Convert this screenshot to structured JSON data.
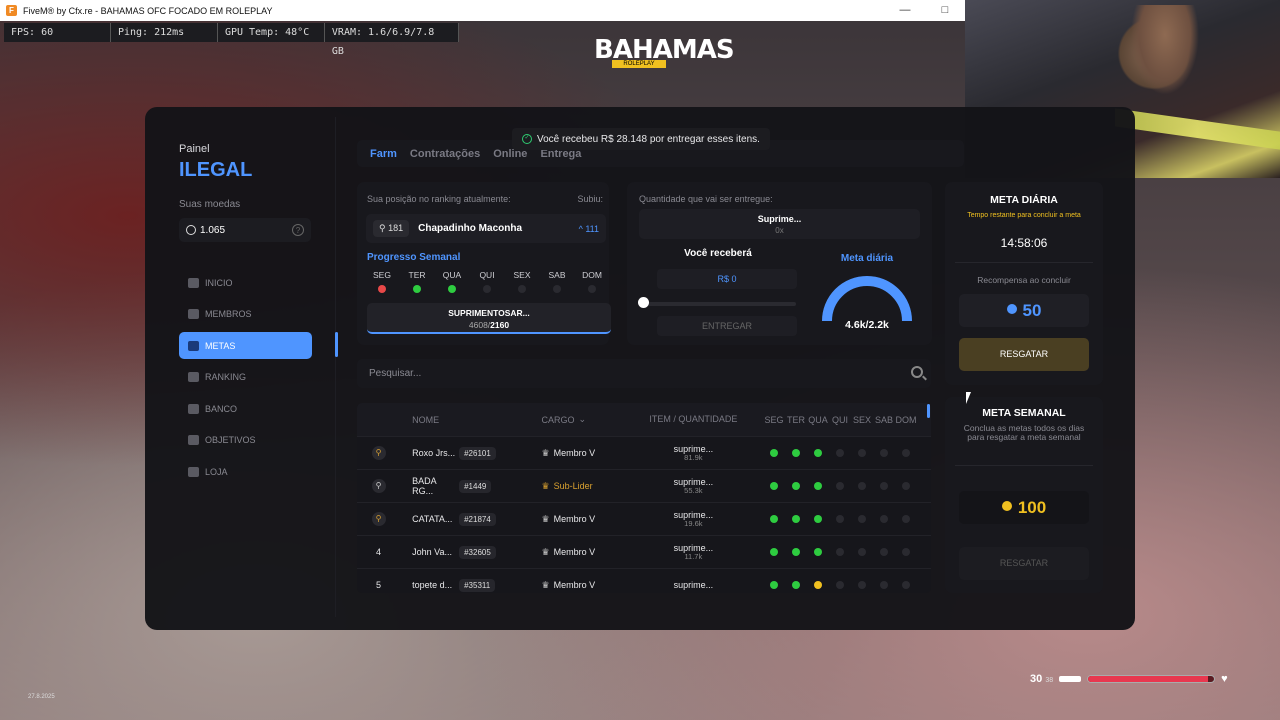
{
  "window": {
    "title": "FiveM® by Cfx.re - BAHAMAS OFC FOCADO EM ROLEPLAY",
    "icon_letter": "F"
  },
  "perf": {
    "fps": "FPS: 60",
    "ping": "Ping: 212ms",
    "gpu": "GPU Temp: 48°C",
    "vram": "VRAM: 1.6/6.9/7.8 GB"
  },
  "logo": {
    "text": "BAHAMAS",
    "sub": "ROLEPLAY"
  },
  "sidebar": {
    "title_small": "Painel",
    "title_big": "ILEGAL",
    "coins_label": "Suas moedas",
    "coins_value": "1.065",
    "help": "?",
    "items": [
      {
        "label": "INICIO",
        "icon": "home-icon"
      },
      {
        "label": "MEMBROS",
        "icon": "users-icon"
      },
      {
        "label": "METAS",
        "icon": "target-icon"
      },
      {
        "label": "RANKING",
        "icon": "ranking-icon"
      },
      {
        "label": "BANCO",
        "icon": "bank-icon"
      },
      {
        "label": "OBJETIVOS",
        "icon": "objectives-icon"
      },
      {
        "label": "LOJA",
        "icon": "shop-icon"
      }
    ],
    "active_index": 2
  },
  "tabs": {
    "farm": "Farm",
    "contratacoes": "Contratações",
    "online": "Online",
    "entrega": "Entrega"
  },
  "toast": "Você recebeu R$ 28.148 por entregar esses itens.",
  "ranking": {
    "label": "Sua posição no ranking atualmente:",
    "subiu": "Subiu:",
    "position": "181",
    "name": "Chapadinho Maconha",
    "up": "^ 111",
    "weekly_title": "Progresso Semanal",
    "days": [
      {
        "d": "SEG",
        "s": "r"
      },
      {
        "d": "TER",
        "s": "g"
      },
      {
        "d": "QUA",
        "s": "g"
      },
      {
        "d": "QUI",
        "s": ""
      },
      {
        "d": "SEX",
        "s": ""
      },
      {
        "d": "SAB",
        "s": ""
      },
      {
        "d": "DOM",
        "s": ""
      }
    ],
    "progress_item": "SUPRIMENTOSAR...",
    "progress_current": "4608/",
    "progress_goal": "2160"
  },
  "delivery": {
    "label": "Quantidade que vai ser entregue:",
    "item": "Suprime...",
    "qty": "0x",
    "receive_label": "Você receberá",
    "amount": "R$ 0",
    "button": "ENTREGAR",
    "slider_value": 0,
    "gauge_title": "Meta diária",
    "gauge_value": "4.6k/2.2k",
    "gauge_fraction": 1
  },
  "search": {
    "placeholder": "Pesquisar..."
  },
  "table": {
    "headers": {
      "nome": "NOME",
      "cargo": "CARGO",
      "item": "ITEM / QUANTIDADE",
      "days": [
        "SEG",
        "TER",
        "QUA",
        "QUI",
        "SEX",
        "SAB",
        "DOM"
      ]
    },
    "rows": [
      {
        "rank": "",
        "medal": "gold",
        "name": "Roxo Jrs...",
        "id": "#26101",
        "cargo": "Membro V",
        "cargo_gold": false,
        "item": "suprime...",
        "qty": "81.9k",
        "days": [
          "g",
          "g",
          "g",
          "",
          "",
          "",
          ""
        ]
      },
      {
        "rank": "",
        "medal": "silver",
        "name": "BADA RG...",
        "id": "#1449",
        "cargo": "Sub-Lider",
        "cargo_gold": true,
        "item": "suprime...",
        "qty": "55.3k",
        "days": [
          "g",
          "g",
          "g",
          "",
          "",
          "",
          ""
        ]
      },
      {
        "rank": "",
        "medal": "gold",
        "name": "CATATA...",
        "id": "#21874",
        "cargo": "Membro V",
        "cargo_gold": false,
        "item": "suprime...",
        "qty": "19.6k",
        "days": [
          "g",
          "g",
          "g",
          "",
          "",
          "",
          ""
        ]
      },
      {
        "rank": "4",
        "medal": "",
        "name": "John Va...",
        "id": "#32605",
        "cargo": "Membro V",
        "cargo_gold": false,
        "item": "suprime...",
        "qty": "11.7k",
        "days": [
          "g",
          "g",
          "g",
          "",
          "",
          "",
          ""
        ]
      },
      {
        "rank": "5",
        "medal": "",
        "name": "topete d...",
        "id": "#35311",
        "cargo": "Membro V",
        "cargo_gold": false,
        "item": "suprime...",
        "qty": "",
        "days": [
          "g",
          "g",
          "y",
          "",
          "",
          "",
          ""
        ]
      }
    ]
  },
  "meta_diaria": {
    "title": "META DIÁRIA",
    "subtitle": "Tempo restante para concluir a meta",
    "time": "14:58:06",
    "reward_label": "Recompensa ao concluir",
    "reward": "50",
    "button": "RESGATAR"
  },
  "meta_semanal": {
    "title": "META SEMANAL",
    "subtitle": "Conclua as metas todos os dias para resgatar a meta semanal",
    "reward": "100",
    "button": "RESGATAR"
  },
  "hud": {
    "ammo": "30",
    "ammo_reserve": "38",
    "health_fraction": 0.95,
    "heart": "♥"
  },
  "date": "27.8.2025",
  "colors": {
    "accent": "#4f95ff",
    "gold": "#f0c020",
    "green": "#2ecc40",
    "red": "#e84848"
  }
}
